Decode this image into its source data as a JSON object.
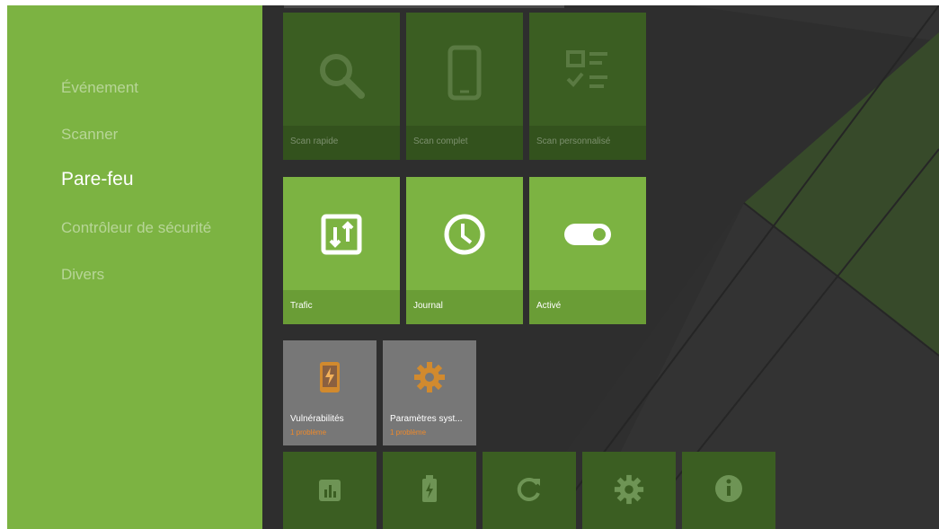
{
  "colors": {
    "accent_green": "#7cb342",
    "dark_green": "#3b5e22",
    "warning_orange": "#f59a23",
    "background": "#2b2b2b"
  },
  "sidebar": {
    "items": [
      {
        "label": "Événement",
        "active": false
      },
      {
        "label": "Scanner",
        "active": false
      },
      {
        "label": "Pare-feu",
        "active": true
      },
      {
        "label": "Contrôleur de sécurité",
        "active": false
      },
      {
        "label": "Divers",
        "active": false
      }
    ]
  },
  "scanner_row": [
    {
      "label": "Scan rapide",
      "icon": "search-icon"
    },
    {
      "label": "Scan complet",
      "icon": "phone-icon"
    },
    {
      "label": "Scan personnalisé",
      "icon": "checklist-icon"
    }
  ],
  "firewall_row": [
    {
      "label": "Trafic",
      "icon": "traffic-icon"
    },
    {
      "label": "Journal",
      "icon": "clock-icon"
    },
    {
      "label": "Activé",
      "icon": "toggle-on-icon"
    }
  ],
  "security_row": [
    {
      "label": "Vulnérabilités",
      "status": "1 problème",
      "icon": "phone-alert-icon"
    },
    {
      "label": "Paramètres syst...",
      "status": "1 problème",
      "icon": "gear-icon"
    }
  ],
  "misc_row": [
    {
      "icon": "bar-chart-icon"
    },
    {
      "icon": "battery-icon"
    },
    {
      "icon": "refresh-icon"
    },
    {
      "icon": "gear-icon"
    },
    {
      "icon": "info-icon"
    }
  ]
}
